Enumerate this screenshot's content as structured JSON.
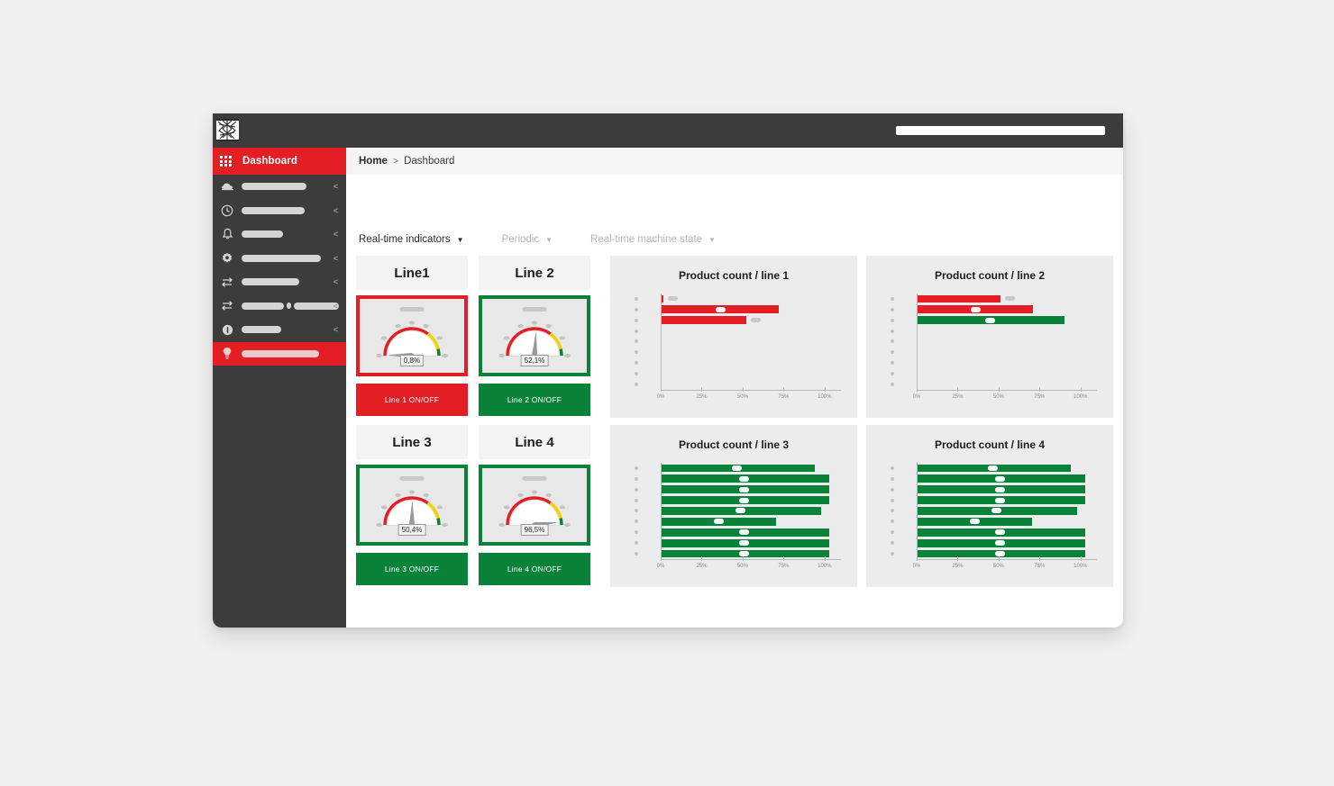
{
  "window": {
    "logo_name": "company-logo-redacted",
    "topbar_field_placeholder": ""
  },
  "breadcrumb": {
    "home": "Home",
    "separator": ">",
    "current": "Dashboard"
  },
  "sidebar": {
    "active_label": "Dashboard",
    "active_icon": "grid-icon",
    "items": [
      {
        "icon": "cloud-icon",
        "label_width": 72,
        "caret": "<",
        "redacted": true
      },
      {
        "icon": "clock-icon",
        "label_width": 70,
        "caret": "<",
        "redacted": true
      },
      {
        "icon": "bell-icon",
        "label_width": 46,
        "caret": "<",
        "redacted": true
      },
      {
        "icon": "gear-icon",
        "label_width": 88,
        "caret": "<",
        "redacted": true
      },
      {
        "icon": "transfer-icon",
        "label_width": 64,
        "caret": "<",
        "redacted": true
      },
      {
        "icon": "transfer-icon",
        "label_width": 58,
        "label_width2": 62,
        "caret": "<",
        "redacted": true,
        "split": true
      },
      {
        "icon": "info-icon",
        "label_width": 44,
        "caret": "<",
        "redacted": true
      },
      {
        "icon": "bulb-icon",
        "label_width": 86,
        "caret": "",
        "redacted": true,
        "highlight": true
      }
    ]
  },
  "filters": [
    {
      "label": "Real-time indicators",
      "caret": "▼",
      "state": "active"
    },
    {
      "label": "Periodic",
      "caret": "▼",
      "state": "muted"
    },
    {
      "label": "Real-time machine state",
      "caret": "▼",
      "state": "muted"
    }
  ],
  "lines": [
    {
      "title": "Line1",
      "status": "alarm",
      "gauge_value": "0,8%",
      "gauge_percent": 0.8,
      "button_label": "Line 1 ON/OFF"
    },
    {
      "title": "Line 2",
      "status": "ok",
      "gauge_value": "52,1%",
      "gauge_percent": 52.1,
      "button_label": "Line 2 ON/OFF"
    },
    {
      "title": "Line 3",
      "status": "ok",
      "gauge_value": "50,4%",
      "gauge_percent": 50.4,
      "button_label": "Line 3 ON/OFF"
    },
    {
      "title": "Line 4",
      "status": "ok",
      "gauge_value": "96,5%",
      "gauge_percent": 96.5,
      "button_label": "Line 4 ON/OFF"
    }
  ],
  "colors": {
    "brand_red": "#e31e24",
    "brand_green": "#0a8239",
    "gauge_yellow": "#f2d200",
    "sidebar_dark": "#3c3c3c",
    "card_bg": "#ececec"
  },
  "chart_data": [
    {
      "type": "bar",
      "orientation": "horizontal",
      "title": "Product count / line 1",
      "xlabel": "",
      "ylabel": "",
      "xlim": [
        0,
        110
      ],
      "xticks": [
        0,
        25,
        50,
        75,
        100
      ],
      "xticklabels": [
        "0%",
        "25%",
        "50%",
        "75%",
        "100%"
      ],
      "grid": false,
      "legend": "none",
      "categories": [
        "",
        "",
        "",
        "",
        "",
        "",
        "",
        "",
        ""
      ],
      "category_labels_redacted": true,
      "values": [
        1,
        72,
        52,
        0,
        0,
        0,
        0,
        0,
        0
      ],
      "bar_colors": [
        "#e31e24",
        "#e31e24",
        "#e31e24",
        null,
        null,
        null,
        null,
        null,
        null
      ],
      "value_labels_redacted": [
        true,
        true,
        true,
        false,
        false,
        false,
        false,
        false,
        false
      ]
    },
    {
      "type": "bar",
      "orientation": "horizontal",
      "title": "Product count / line 2",
      "xlabel": "",
      "ylabel": "",
      "xlim": [
        0,
        110
      ],
      "xticks": [
        0,
        25,
        50,
        75,
        100
      ],
      "xticklabels": [
        "0%",
        "25%",
        "50%",
        "75%",
        "100%"
      ],
      "grid": false,
      "legend": "none",
      "categories": [
        "",
        "",
        "",
        "",
        "",
        "",
        "",
        "",
        ""
      ],
      "category_labels_redacted": true,
      "values": [
        51,
        71,
        90,
        0,
        0,
        0,
        0,
        0,
        0
      ],
      "bar_colors": [
        "#e31e24",
        "#e31e24",
        "#0a8239",
        null,
        null,
        null,
        null,
        null,
        null
      ],
      "value_labels_redacted": [
        true,
        true,
        true,
        false,
        false,
        false,
        false,
        false,
        false
      ]
    },
    {
      "type": "bar",
      "orientation": "horizontal",
      "title": "Product count / line 3",
      "xlabel": "",
      "ylabel": "",
      "xlim": [
        0,
        110
      ],
      "xticks": [
        0,
        25,
        50,
        75,
        100
      ],
      "xticklabels": [
        "0%",
        "25%",
        "50%",
        "75%",
        "100%"
      ],
      "grid": false,
      "legend": "none",
      "categories": [
        "",
        "",
        "",
        "",
        "",
        "",
        "",
        "",
        ""
      ],
      "category_labels_redacted": true,
      "values": [
        94,
        103,
        103,
        103,
        98,
        70,
        103,
        103,
        103
      ],
      "bar_colors": [
        "#0a8239",
        "#0a8239",
        "#0a8239",
        "#0a8239",
        "#0a8239",
        "#0a8239",
        "#0a8239",
        "#0a8239",
        "#0a8239"
      ],
      "value_labels_redacted": [
        true,
        true,
        true,
        true,
        true,
        true,
        true,
        true,
        true
      ]
    },
    {
      "type": "bar",
      "orientation": "horizontal",
      "title": "Product count / line 4",
      "xlabel": "",
      "ylabel": "",
      "xlim": [
        0,
        110
      ],
      "xticks": [
        0,
        25,
        50,
        75,
        100
      ],
      "xticklabels": [
        "0%",
        "25%",
        "50%",
        "75%",
        "100%"
      ],
      "grid": false,
      "legend": "none",
      "categories": [
        "",
        "",
        "",
        "",
        "",
        "",
        "",
        "",
        ""
      ],
      "category_labels_redacted": true,
      "values": [
        94,
        103,
        103,
        103,
        98,
        70,
        103,
        103,
        103
      ],
      "bar_colors": [
        "#0a8239",
        "#0a8239",
        "#0a8239",
        "#0a8239",
        "#0a8239",
        "#0a8239",
        "#0a8239",
        "#0a8239",
        "#0a8239"
      ],
      "value_labels_redacted": [
        true,
        true,
        true,
        true,
        true,
        true,
        true,
        true,
        true
      ]
    }
  ]
}
